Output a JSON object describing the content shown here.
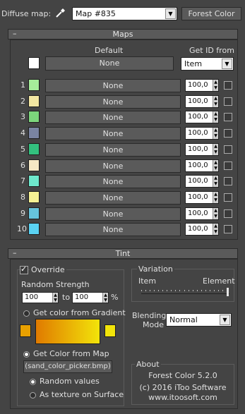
{
  "header": {
    "diffuse_label": "Diffuse map:",
    "eyedropper_icon": "eyedropper-icon",
    "map_value": "Map #835",
    "plugin_button": "Forest Color"
  },
  "maps": {
    "title": "Maps",
    "collapse": "–",
    "default_label": "Default",
    "get_id_label": "Get ID from",
    "default_button": "None",
    "default_color": "#ffffff",
    "get_id_value": "Item",
    "rows": [
      {
        "num": "1",
        "color": "#a6ec9a",
        "button": "None",
        "spin": "100,0"
      },
      {
        "num": "2",
        "color": "#f2e6a2",
        "button": "None",
        "spin": "100,0"
      },
      {
        "num": "3",
        "color": "#7cd67c",
        "button": "None",
        "spin": "100,0"
      },
      {
        "num": "4",
        "color": "#7a84a2",
        "button": "None",
        "spin": "100,0"
      },
      {
        "num": "5",
        "color": "#33c07e",
        "button": "None",
        "spin": "100,0"
      },
      {
        "num": "6",
        "color": "#f5e8c4",
        "button": "None",
        "spin": "100,0"
      },
      {
        "num": "7",
        "color": "#6ee8cc",
        "button": "None",
        "spin": "100,0"
      },
      {
        "num": "8",
        "color": "#f6f294",
        "button": "None",
        "spin": "100,0"
      },
      {
        "num": "9",
        "color": "#66c4dc",
        "button": "None",
        "spin": "100,0"
      },
      {
        "num": "10",
        "color": "#5ad2f2",
        "button": "None",
        "spin": "100,0"
      }
    ]
  },
  "tint": {
    "title": "Tint",
    "collapse": "–",
    "override_label": "Override",
    "random_strength_label": "Random Strength",
    "from_value": "100",
    "to_label": "to",
    "to_value": "100",
    "percent_label": "%",
    "gradient_option": "Get color from Gradient",
    "gradient_start_color": "#e8a000",
    "gradient_end_color": "#f2e40a",
    "gradient_mid_color": "#e07a00",
    "map_option": "Get Color from Map",
    "map_button": "(sand_color_picker.bmp)",
    "random_values_option": "Random values",
    "texture_option": "As texture on Surface",
    "variation_title": "Variation",
    "variation_left": "Item",
    "variation_right": "Element",
    "variation_level": 1.0,
    "blending_label_1": "Blending",
    "blending_label_2": "Mode",
    "blending_value": "Normal",
    "about_title": "About",
    "about_line1": "Forest Color 5.2.0",
    "about_line2": "(c) 2016 iToo Software",
    "about_line3": "www.itoosoft.com"
  }
}
